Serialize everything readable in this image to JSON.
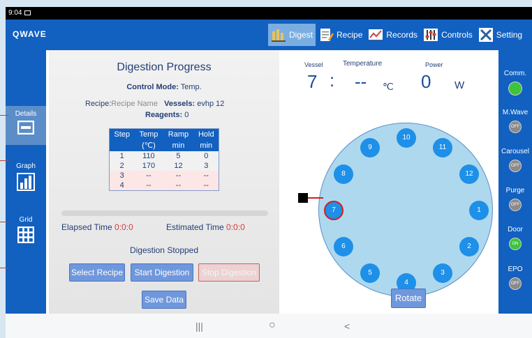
{
  "status_bar": {
    "time": "9:04"
  },
  "app": {
    "logo": "QWAVE"
  },
  "tabs": [
    {
      "label": "Digest",
      "icon": "digest-icon",
      "active": true
    },
    {
      "label": "Recipe",
      "icon": "recipe-icon",
      "active": false
    },
    {
      "label": "Records",
      "icon": "records-icon",
      "active": false
    },
    {
      "label": "Controls",
      "icon": "controls-icon",
      "active": false
    },
    {
      "label": "Setting",
      "icon": "settings-icon",
      "active": false
    }
  ],
  "sidebar": {
    "items": [
      {
        "label": "Details",
        "icon": "details-icon",
        "active": true
      },
      {
        "label": "Graph",
        "icon": "bar-chart-icon",
        "active": false
      },
      {
        "label": "Grid",
        "icon": "grid-icon",
        "active": false
      }
    ]
  },
  "progress_panel": {
    "title": "Digestion Progress",
    "control_mode_label": "Control Mode:",
    "control_mode_value": "Temp.",
    "recipe_label": "Recipe:",
    "recipe_value": "Recipe Name",
    "vessels_label": "Vessels:",
    "vessels_value": "evhp 12",
    "reagents_label": "Reagents:",
    "reagents_value": "0",
    "table": {
      "headers": [
        [
          "Step",
          ""
        ],
        [
          "Temp",
          "(℃)"
        ],
        [
          "Ramp",
          "min"
        ],
        [
          "Hold",
          "min"
        ]
      ],
      "rows": [
        [
          "1",
          "110",
          "5",
          "0"
        ],
        [
          "2",
          "170",
          "12",
          "3"
        ],
        [
          "3",
          "--",
          "--",
          "--"
        ],
        [
          "4",
          "--",
          "--",
          "--"
        ]
      ]
    },
    "progress_fraction": 0,
    "elapsed_label": "Elapsed Time",
    "elapsed_value": "0:0:0",
    "estimated_label": "Estimated Time",
    "estimated_value": "0:0:0",
    "status": "Digestion Stopped",
    "buttons": {
      "select_recipe": "Select Recipe",
      "start_digestion": "Start Digestion",
      "stop_digestion": "Stop Digestion",
      "save_data": "Save Data"
    }
  },
  "readout": {
    "vessel_label": "Vessel",
    "vessel_value": "7",
    "separator": ":",
    "temperature_label": "Temperature",
    "temperature_value": "--",
    "temperature_unit": "℃",
    "power_label": "Power",
    "power_value": "0",
    "power_unit": "W"
  },
  "carousel": {
    "vessels": [
      "1",
      "2",
      "3",
      "4",
      "5",
      "6",
      "7",
      "8",
      "9",
      "10",
      "11",
      "12"
    ],
    "selected": "7",
    "rotate_label": "Rotate"
  },
  "status_panel": [
    {
      "label": "Comm.",
      "state": "",
      "color": "#3cc43c"
    },
    {
      "label": "M.Wave",
      "state": "OFF",
      "color": "#8a8a8a"
    },
    {
      "label": "Carousel",
      "state": "OFF",
      "color": "#8a8a8a"
    },
    {
      "label": "Purge",
      "state": "OFF",
      "color": "#8a8a8a"
    },
    {
      "label": "Door",
      "state": "ON",
      "color": "#3cc43c"
    },
    {
      "label": "EPO",
      "state": "OFF",
      "color": "#8a8a8a"
    }
  ],
  "nav": {
    "recents": "|||",
    "home": "○",
    "back": "<"
  }
}
